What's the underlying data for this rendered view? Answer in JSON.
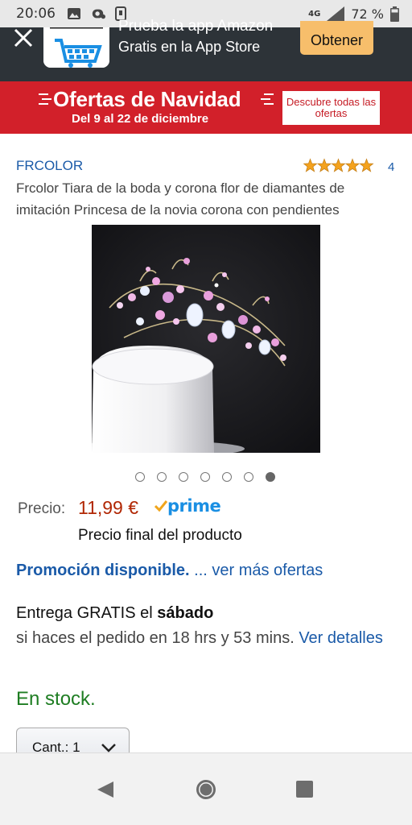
{
  "status_bar": {
    "time": "20:06",
    "network": "4G",
    "battery": "72 %",
    "icons": [
      "image-icon",
      "sync-icon",
      "phone-icon",
      "signal-icon",
      "battery-icon"
    ]
  },
  "app_banner": {
    "title": "Prueba la app Amazon",
    "subtitle": "Gratis en la App Store",
    "button": "Obtener",
    "button_color": "#f7be6b",
    "background": "#2d3338"
  },
  "promo": {
    "title": "Ofertas de Navidad",
    "dates": "Del 9 al 22 de diciembre",
    "button": "Descubre todas las ofertas",
    "background": "#d2202a"
  },
  "product": {
    "brand": "FRCOLOR",
    "rating_stars": 5,
    "rating_count": "4",
    "title": "Frcolor Tiara de la boda y corona flor de diamantes de imitación Princesa de la novia corona con pendientes",
    "image_count": 7,
    "active_image": 7
  },
  "price": {
    "label": "Precio:",
    "value": "11,99 €",
    "prime": "prime",
    "note": "Precio final del producto",
    "color": "#b12704"
  },
  "promotion": {
    "label": "Promoción disponible.",
    "more": "... ver más ofertas"
  },
  "delivery": {
    "prefix": "Entrega GRATIS el ",
    "day": "sábado",
    "text": "si haces el pedido en 18 hrs y 53 mins. ",
    "link": "Ver detalles"
  },
  "stock": {
    "label": "En stock.",
    "color": "#1e7d22"
  },
  "quantity": {
    "label": "Cant.: 1"
  },
  "nav_bar": {
    "icons": [
      "back-icon",
      "home-icon",
      "recents-icon"
    ]
  }
}
